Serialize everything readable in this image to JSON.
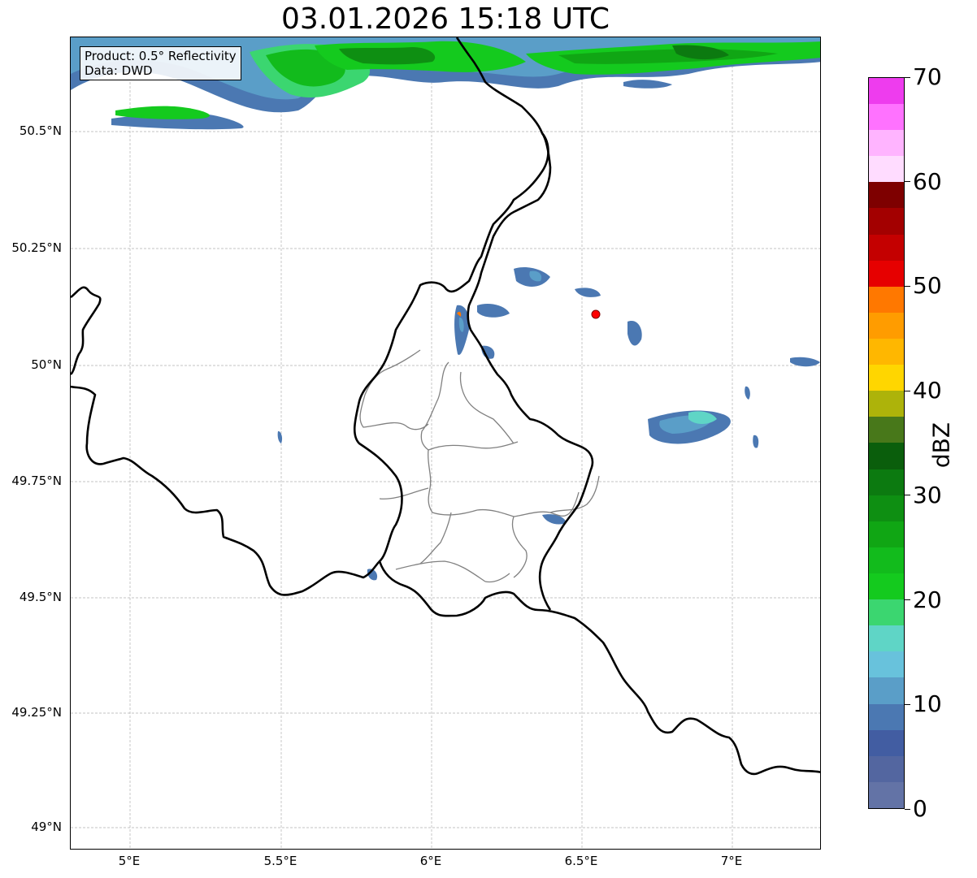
{
  "title": "03.01.2026 15:18 UTC",
  "info_box": {
    "product": "Product: 0.5° Reflectivity",
    "data": "Data: DWD"
  },
  "axes": {
    "lat_ticks": [
      "50.5°N",
      "50.25°N",
      "50°N",
      "49.75°N",
      "49.5°N",
      "49.25°N",
      "49°N"
    ],
    "lon_ticks": [
      "5°E",
      "5.5°E",
      "6°E",
      "6.5°E",
      "7°E"
    ]
  },
  "colorbar": {
    "unit": "dBZ",
    "ticks": [
      "0",
      "10",
      "20",
      "30",
      "40",
      "50",
      "60",
      "70"
    ],
    "colors": [
      "#6373a6",
      "#5366a0",
      "#425da2",
      "#4b78b2",
      "#5a9ec8",
      "#68c2dc",
      "#5fd5c6",
      "#3bd670",
      "#14ca1e",
      "#12bb1c",
      "#10a614",
      "#0e8f12",
      "#0c7a10",
      "#0a5e0c",
      "#48781a",
      "#adb30a",
      "#ffd600",
      "#ffb700",
      "#ff9c00",
      "#ff7800",
      "#e60000",
      "#c40000",
      "#a30000",
      "#7e0000",
      "#ffdcff",
      "#ffb4ff",
      "#ff72ff",
      "#ee3cee"
    ]
  },
  "marker": {
    "name": "radar-site",
    "color": "#ff0000"
  },
  "colors": {
    "border": "#000000",
    "admin": "#808080",
    "grid": "#b0b0b0"
  }
}
